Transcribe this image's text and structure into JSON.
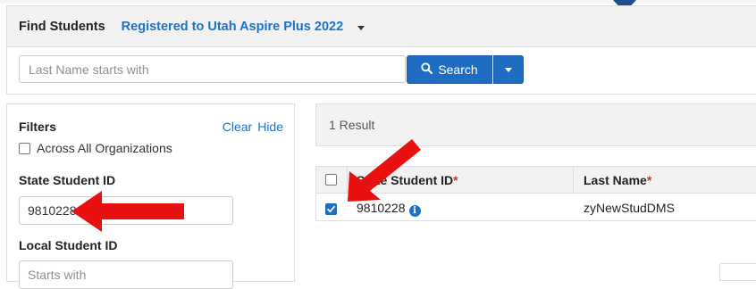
{
  "find": {
    "title": "Find Students",
    "scope_label": "Registered to Utah Aspire Plus 2022",
    "search_placeholder": "Last Name starts with",
    "search_button": "Search"
  },
  "filters": {
    "title": "Filters",
    "clear": "Clear",
    "hide": "Hide",
    "across_label": "Across All Organizations",
    "across_checked": false,
    "state_id_label": "State Student ID",
    "state_id_value": "9810228",
    "local_id_label": "Local Student ID",
    "local_id_placeholder": "Starts with"
  },
  "results": {
    "count_text": "1 Result",
    "columns": [
      {
        "label": "State Student ID",
        "required_mark": "*"
      },
      {
        "label": "Last Name",
        "required_mark": "*"
      }
    ],
    "rows": [
      {
        "checked": true,
        "state_student_id": "9810228",
        "last_name": "zyNewStudDMS"
      }
    ]
  },
  "annotations": {
    "arrow_color": "#e81010",
    "accent": "#1f6dc2",
    "link_color": "#1a73c8"
  },
  "icons": {
    "search": "magnifier-icon",
    "info": "info-circle-icon",
    "dropdown": "caret-down-icon"
  }
}
